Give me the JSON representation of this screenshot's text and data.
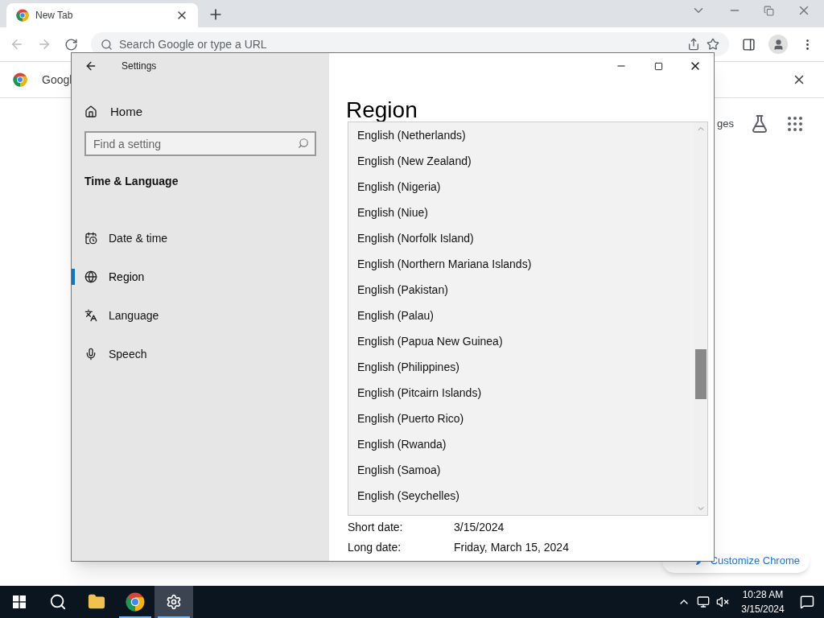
{
  "browser": {
    "tabs": [
      {
        "title": "New Tab",
        "selected": true
      }
    ],
    "address_placeholder": "Search Google or type a URL",
    "infobar": {
      "text": "Googl"
    },
    "page": {
      "link_text": "ges",
      "customize_button": "Customize Chrome"
    }
  },
  "settings": {
    "title": "Settings",
    "home": "Home",
    "search_placeholder": "Find a setting",
    "section": "Time & Language",
    "nav": [
      {
        "label": "Date & time",
        "selected": false
      },
      {
        "label": "Region",
        "selected": true
      },
      {
        "label": "Language",
        "selected": false
      },
      {
        "label": "Speech",
        "selected": false
      }
    ],
    "heading": "Region",
    "dropdown_options": [
      "English (Netherlands)",
      "English (New Zealand)",
      "English (Nigeria)",
      "English (Niue)",
      "English (Norfolk Island)",
      "English (Northern Mariana Islands)",
      "English (Pakistan)",
      "English (Palau)",
      "English (Papua New Guinea)",
      "English (Philippines)",
      "English (Pitcairn Islands)",
      "English (Puerto Rico)",
      "English (Rwanda)",
      "English (Samoa)",
      "English (Seychelles)"
    ],
    "formats": [
      {
        "label": "Short date:",
        "value": "3/15/2024"
      },
      {
        "label": "Long date:",
        "value": "Friday, March 15, 2024"
      }
    ]
  },
  "taskbar": {
    "apps": [
      {
        "kind": "start",
        "active": false,
        "running": false
      },
      {
        "kind": "search",
        "active": false,
        "running": false
      },
      {
        "kind": "explorer",
        "active": false,
        "running": false
      },
      {
        "kind": "chrome",
        "active": false,
        "running": true
      },
      {
        "kind": "settings",
        "active": true,
        "running": true
      }
    ],
    "time": "10:28 AM",
    "date": "3/15/2024"
  }
}
